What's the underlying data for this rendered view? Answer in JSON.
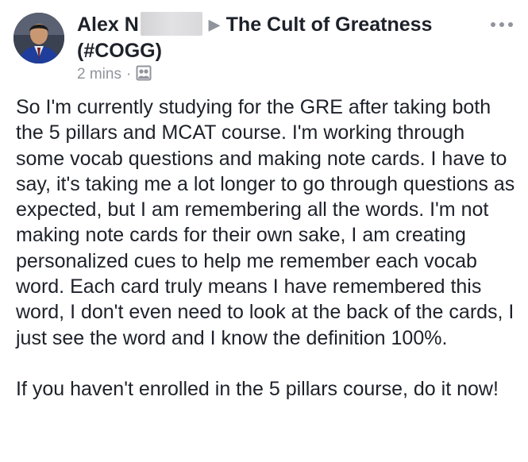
{
  "post": {
    "author_name": "Alex N",
    "group_name": "The Cult of Greatness",
    "group_tag": "(#COGG)",
    "timestamp": "2 mins",
    "separator": "·",
    "paragraphs": [
      "So I'm currently studying for the GRE after taking both the 5 pillars and MCAT course. I'm working through some vocab questions and making note cards. I have to say, it's taking me a lot longer to go through questions as expected, but I am remembering all the words. I'm not making note cards for their own sake, I am creating personalized cues to help me remember each vocab word. Each card truly means I have remembered this word, I don't even need to look at the back of the cards, I just see the word and I know the definition 100%.",
      "If you haven't enrolled in the 5 pillars course, do it now!"
    ]
  },
  "icons": {
    "arrow": "right-triangle-arrow",
    "privacy": "group-members-icon",
    "more": "more-options-icon"
  },
  "colors": {
    "text": "#1d2129",
    "meta": "#90949c"
  }
}
